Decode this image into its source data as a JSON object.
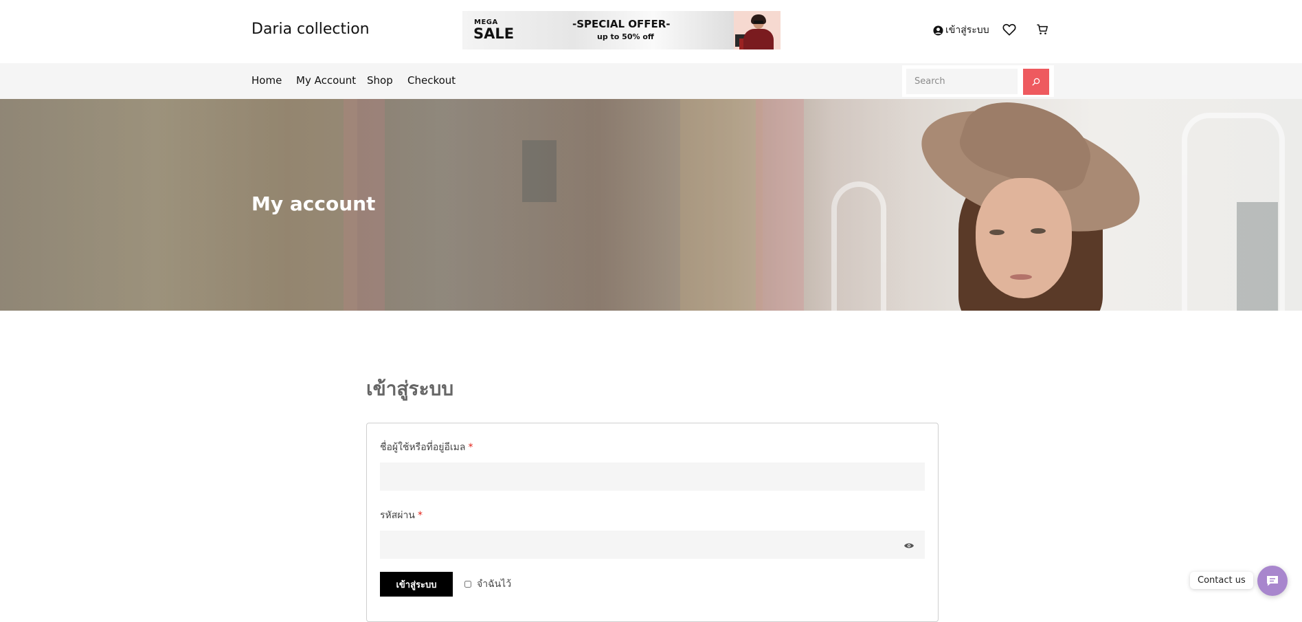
{
  "header": {
    "brand": "Daria collection",
    "promo": {
      "mega": "MEGA",
      "sale": "SALE",
      "offer": "-SPECIAL OFFER-",
      "sub": "up to 50% off"
    },
    "login_label": "เข้าสู่ระบบ",
    "icons": [
      "user-icon",
      "heart-icon",
      "cart-icon"
    ]
  },
  "nav": {
    "items": [
      "Home",
      "My Account",
      "Shop",
      "Checkout"
    ],
    "search_placeholder": "Search",
    "search_icon": "search-icon"
  },
  "hero": {
    "title": "My account"
  },
  "login": {
    "title": "เข้าสู่ระบบ",
    "username_label": "ชื่อผู้ใช้หรือที่อยู่อีเมล",
    "password_label": "รหัสผ่าน",
    "required_mark": "*",
    "username_value": "",
    "password_value": "",
    "submit_label": "เข้าสู่ระบบ",
    "remember_label": "จำฉันไว้"
  },
  "contact": {
    "label": "Contact us"
  },
  "colors": {
    "accent_search": "#ee5a5f",
    "contact_bubble": "#a886cd",
    "required": "#e2231a"
  }
}
